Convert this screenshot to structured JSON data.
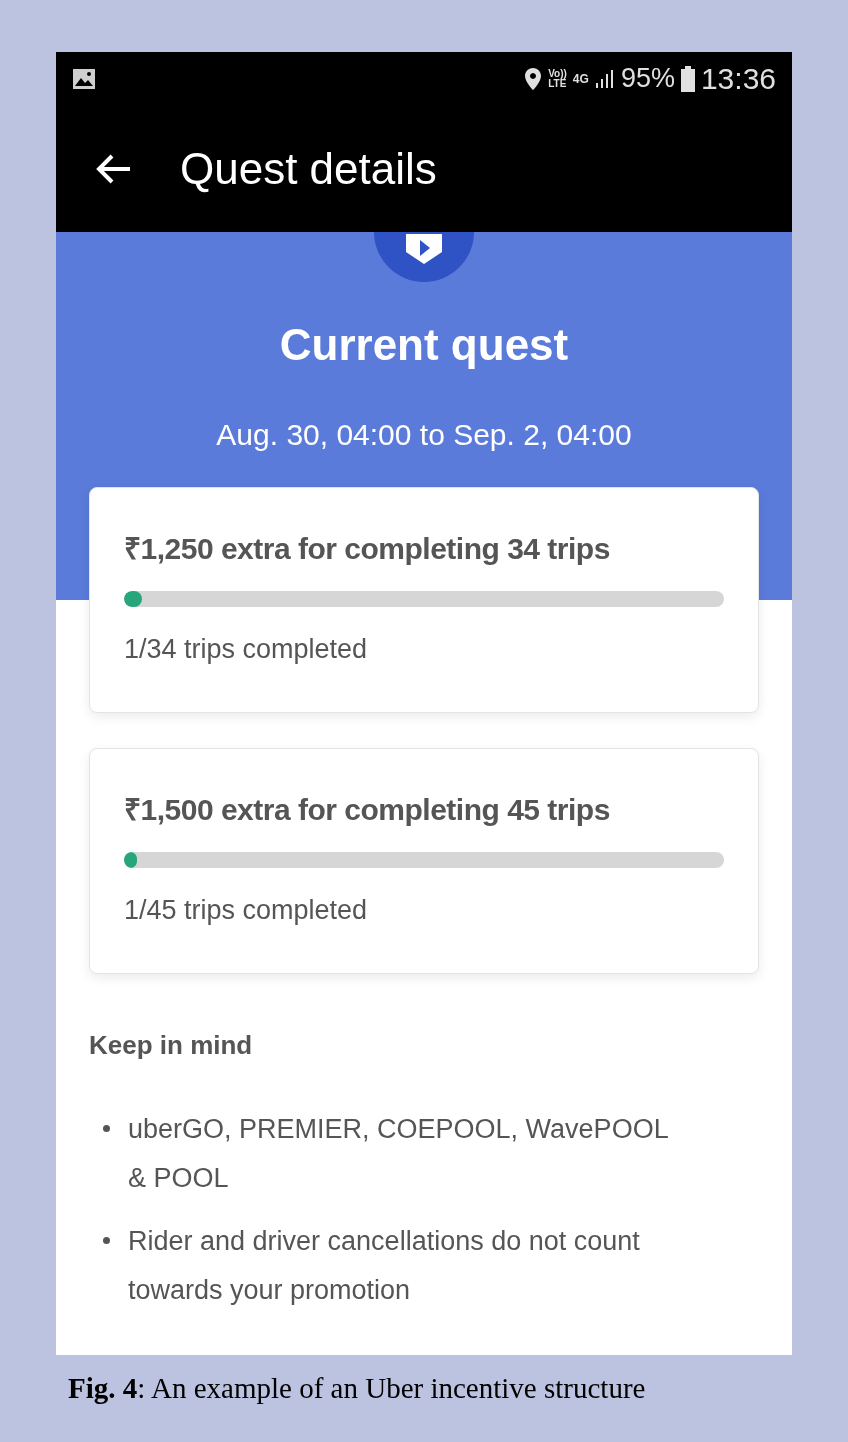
{
  "status_bar": {
    "volte": [
      "Vo))",
      "LTE"
    ],
    "network": "4G",
    "battery": "95%",
    "time": "13:36"
  },
  "app_bar": {
    "title": "Quest details"
  },
  "hero": {
    "title": "Current quest",
    "period": "Aug. 30, 04:00 to Sep. 2, 04:00"
  },
  "quests": [
    {
      "title": "₹1,250 extra for completing 34 trips",
      "level": 0.03,
      "progress": "1/34 trips completed"
    },
    {
      "title": "₹1,500 extra for completing 45 trips",
      "level": 0.022,
      "progress": "1/45 trips completed"
    }
  ],
  "notes": {
    "heading": "Keep in mind",
    "items": [
      "uberGO, PREMIER, COEPOOL, WavePOOL & POOL",
      "Rider and driver cancellations do not count towards your promotion"
    ]
  },
  "caption": "**Fig. 4**: An example of an Uber incentive structure"
}
